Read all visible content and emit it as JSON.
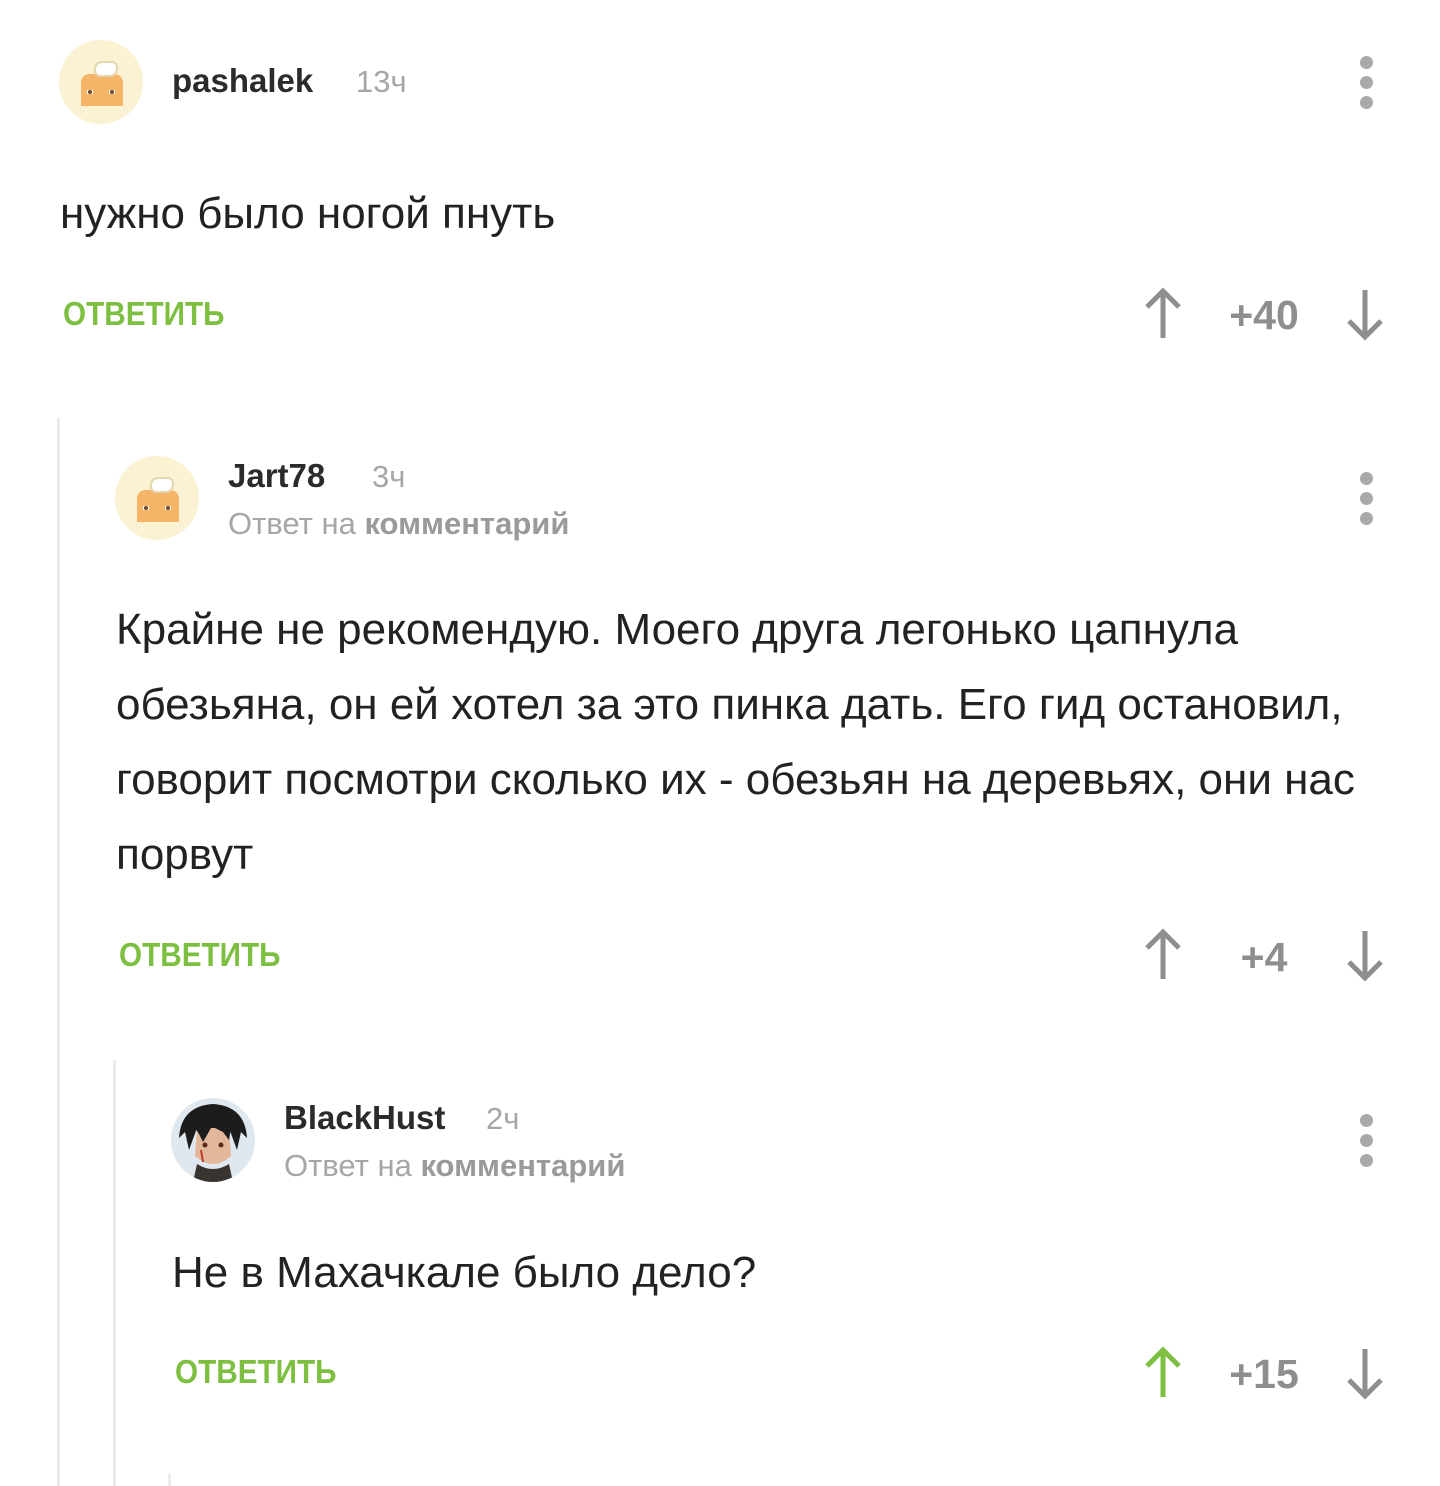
{
  "comments": [
    {
      "username": "pashalek",
      "time": "13ч",
      "text": "нужно было ногой пнуть",
      "reply_label": "ОТВЕТИТЬ",
      "score": "+40",
      "upvote_active": false
    },
    {
      "username": "Jart78",
      "time": "3ч",
      "reply_to_prefix": "Ответ на",
      "reply_to_target": "комментарий",
      "text": "Крайне не рекомендую. Моего друга легонько цапнула обезьяна, он ей хотел за это пинка дать. Его гид остановил, говорит посмотри сколько их - обезьян на деревьях, они нас порвут",
      "reply_label": "ОТВЕТИТЬ",
      "score": "+4",
      "upvote_active": false
    },
    {
      "username": "BlackHust",
      "time": "2ч",
      "reply_to_prefix": "Ответ на",
      "reply_to_target": "комментарий",
      "text": "Не в Махачкале было дело?",
      "reply_label": "ОТВЕТИТЬ",
      "score": "+15",
      "upvote_active": true
    }
  ],
  "colors": {
    "accent_green": "#7dbf40",
    "muted_gray": "#a6a6a6",
    "thread_line": "#ececec"
  },
  "icons": {
    "default_avatar": "pikabu-default-avatar-icon",
    "user_avatar": "anime-character-avatar-icon",
    "menu": "vertical-dots-icon",
    "upvote": "arrow-up-icon",
    "downvote": "arrow-down-icon"
  }
}
